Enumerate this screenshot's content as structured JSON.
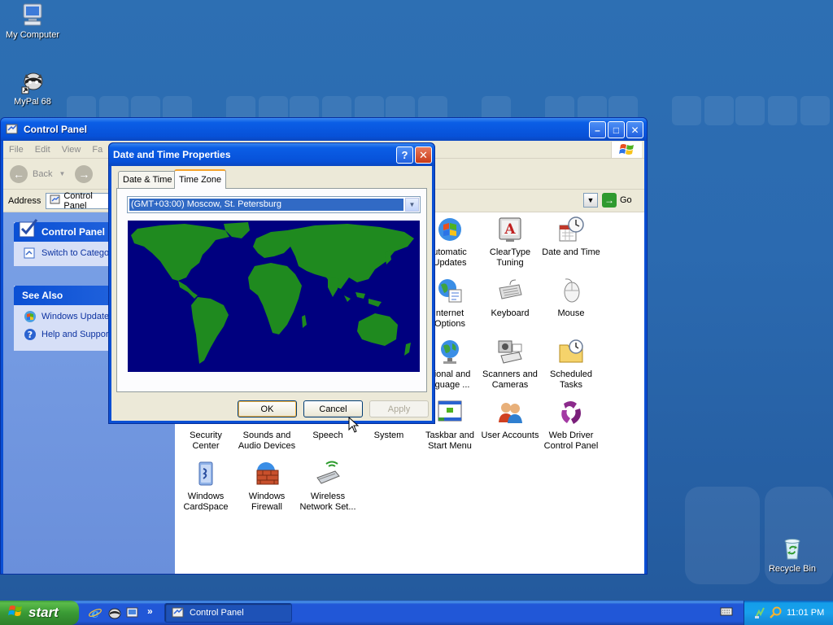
{
  "desktop": {
    "icons": [
      {
        "label": "My Computer"
      },
      {
        "label": "MyPal 68"
      },
      {
        "label": "Recycle Bin"
      }
    ]
  },
  "control_panel": {
    "title": "Control Panel",
    "menu": [
      "File",
      "Edit",
      "View",
      "Fa"
    ],
    "toolbar": {
      "back_label": "Back"
    },
    "address": {
      "label": "Address",
      "value": "Control Panel",
      "go_label": "Go"
    },
    "left_pane": {
      "control_panel_heading": "Control Panel",
      "switch_view": "Switch to Catego",
      "see_also_heading": "See Also",
      "see_also_items": [
        "Windows Update",
        "Help and Suppor"
      ]
    },
    "items": [
      {
        "label": "utomatic\nUpdates",
        "icon": "automatic-updates-icon"
      },
      {
        "label": "ClearType\nTuning",
        "icon": "cleartype-icon"
      },
      {
        "label": "Date and Time",
        "icon": "date-time-icon"
      },
      {
        "label": "nternet\nOptions",
        "icon": "internet-options-icon"
      },
      {
        "label": "Keyboard",
        "icon": "keyboard-icon"
      },
      {
        "label": "Mouse",
        "icon": "mouse-icon"
      },
      {
        "label": "gional and\nnguage ...",
        "icon": "regional-icon"
      },
      {
        "label": "Scanners and\nCameras",
        "icon": "scanner-icon"
      },
      {
        "label": "Scheduled\nTasks",
        "icon": "scheduled-tasks-icon"
      },
      {
        "label": "Security\nCenter",
        "icon": "security-center-icon"
      },
      {
        "label": "Sounds and\nAudio Devices",
        "icon": "sounds-icon"
      },
      {
        "label": "Speech",
        "icon": "speech-icon"
      },
      {
        "label": "System",
        "icon": "system-icon"
      },
      {
        "label": "Taskbar and\nStart Menu",
        "icon": "taskbar-icon"
      },
      {
        "label": "User Accounts",
        "icon": "user-accounts-icon"
      },
      {
        "label": "Web Driver\nControl Panel",
        "icon": "web-driver-icon"
      },
      {
        "label": "Windows\nCardSpace",
        "icon": "cardspace-icon"
      },
      {
        "label": "Windows\nFirewall",
        "icon": "firewall-icon"
      },
      {
        "label": "Wireless\nNetwork Set...",
        "icon": "wireless-icon"
      }
    ]
  },
  "dialog": {
    "title": "Date and Time Properties",
    "help": "?",
    "close": "✕",
    "tabs": [
      {
        "label": "Date & Time",
        "active": false
      },
      {
        "label": "Time Zone",
        "active": true
      }
    ],
    "timezone_value": "(GMT+03:00) Moscow, St. Petersburg",
    "buttons": {
      "ok": "OK",
      "cancel": "Cancel",
      "apply": "Apply"
    }
  },
  "taskbar": {
    "start_label": "start",
    "quicklaunch_more": "»",
    "task_button_label": "Control Panel",
    "clock": "11:01 PM"
  },
  "colors": {
    "desktop": "#2b6ab0",
    "xp_blue": "#0a4fd4",
    "map_ocean": "#00007f",
    "map_land": "#1f8a1f",
    "selection": "#316ac5"
  }
}
